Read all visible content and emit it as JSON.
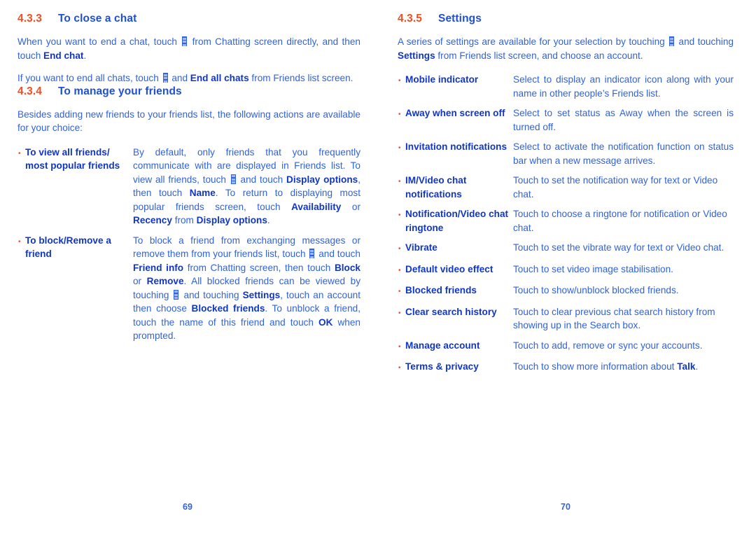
{
  "document": {
    "menu_icon_name": "overflow-menu-icon",
    "accent_orange": "#F04E23",
    "text_blue": "#2F62DE",
    "bold_blue": "#1036C4"
  },
  "left_page": {
    "page_number": "69",
    "sections": [
      {
        "number": "4.3.3",
        "title": "To close a chat",
        "paragraphs": [
          {
            "parts": [
              {
                "t": "text",
                "v": "When you want to end a chat, touch "
              },
              {
                "t": "icon",
                "v": "overflow-menu-icon"
              },
              {
                "t": "text",
                "v": " from Chatting screen directly, and then touch "
              },
              {
                "t": "bold",
                "v": "End chat"
              },
              {
                "t": "text",
                "v": "."
              }
            ]
          },
          {
            "parts": [
              {
                "t": "text",
                "v": "If you want to end all chats, touch "
              },
              {
                "t": "icon",
                "v": "overflow-menu-icon"
              },
              {
                "t": "text",
                "v": " and "
              },
              {
                "t": "bold",
                "v": "End all chats"
              },
              {
                "t": "text",
                "v": " from Friends list screen."
              }
            ]
          }
        ]
      },
      {
        "number": "4.3.4",
        "title": "To manage your friends",
        "paragraphs": [
          {
            "parts": [
              {
                "t": "text",
                "v": "Besides adding new friends to your friends list, the following actions are available for your choice:"
              }
            ]
          }
        ],
        "items": [
          {
            "term": "To view all friends/ most popular friends",
            "desc_parts": [
              {
                "t": "text",
                "v": "By default, only friends that you frequently communicate with are displayed in Friends list. To view all friends, touch "
              },
              {
                "t": "icon",
                "v": "overflow-menu-icon"
              },
              {
                "t": "text",
                "v": " and touch "
              },
              {
                "t": "bold",
                "v": "Display options"
              },
              {
                "t": "text",
                "v": ", then touch "
              },
              {
                "t": "bold",
                "v": "Name"
              },
              {
                "t": "text",
                "v": ". To return to displaying most popular friends screen,  touch "
              },
              {
                "t": "bold",
                "v": "Availability"
              },
              {
                "t": "text",
                "v": " or "
              },
              {
                "t": "bold",
                "v": "Recency"
              },
              {
                "t": "text",
                "v": " from "
              },
              {
                "t": "bold",
                "v": "Display options"
              },
              {
                "t": "text",
                "v": "."
              }
            ]
          },
          {
            "term": "To block/Remove a friend",
            "desc_parts": [
              {
                "t": "text",
                "v": "To block a friend from exchanging messages or remove them from your friends list, touch "
              },
              {
                "t": "icon",
                "v": "overflow-menu-icon"
              },
              {
                "t": "text",
                "v": " and touch "
              },
              {
                "t": "bold",
                "v": "Friend info"
              },
              {
                "t": "text",
                "v": " from Chatting screen, then touch "
              },
              {
                "t": "bold",
                "v": "Block"
              },
              {
                "t": "text",
                "v": " or "
              },
              {
                "t": "bold",
                "v": "Remove"
              },
              {
                "t": "text",
                "v": ". All blocked friends can be viewed by touching "
              },
              {
                "t": "icon",
                "v": "overflow-menu-icon"
              },
              {
                "t": "text",
                "v": " and touching "
              },
              {
                "t": "bold",
                "v": "Settings"
              },
              {
                "t": "text",
                "v": ", touch an account then choose "
              },
              {
                "t": "bold",
                "v": "Blocked friends"
              },
              {
                "t": "text",
                "v": ". To unblock a friend, touch the name of this friend and touch "
              },
              {
                "t": "bold",
                "v": "OK"
              },
              {
                "t": "text",
                "v": " when prompted."
              }
            ]
          }
        ]
      }
    ]
  },
  "right_page": {
    "page_number": "70",
    "sections": [
      {
        "number": "4.3.5",
        "title": "Settings",
        "paragraphs": [
          {
            "parts": [
              {
                "t": "text",
                "v": "A series of settings are available for your selection by touching "
              },
              {
                "t": "icon",
                "v": "overflow-menu-icon"
              },
              {
                "t": "text",
                "v": " and touching "
              },
              {
                "t": "bold",
                "v": "Settings"
              },
              {
                "t": "text",
                "v": " from Friends list screen, and choose an account."
              }
            ]
          }
        ],
        "items": [
          {
            "term": "Mobile indicator",
            "justify": true,
            "desc_parts": [
              {
                "t": "text",
                "v": "Select to display an indicator icon along with your name in other people’s Friends list."
              }
            ]
          },
          {
            "term": "Away when screen off",
            "justify": true,
            "desc_parts": [
              {
                "t": "text",
                "v": "Select to set status as Away when the screen is turned off."
              }
            ]
          },
          {
            "term": "Invitation notifications",
            "justify": true,
            "desc_parts": [
              {
                "t": "text",
                "v": "Select to activate the notification function on status bar when a new message arrives."
              }
            ]
          },
          {
            "term": "IM/Video chat notifications",
            "justify": false,
            "desc_parts": [
              {
                "t": "text",
                "v": "Touch to set the notification way for text or Video chat."
              }
            ]
          },
          {
            "term": "Notification/Video chat ringtone",
            "justify": false,
            "desc_parts": [
              {
                "t": "text",
                "v": "Touch to choose a ringtone for notification or Video chat."
              }
            ]
          },
          {
            "term": "Vibrate",
            "justify": false,
            "desc_parts": [
              {
                "t": "text",
                "v": "Touch to set the vibrate way for text or Video chat."
              }
            ]
          },
          {
            "term": "Default video effect",
            "justify": false,
            "desc_parts": [
              {
                "t": "text",
                "v": "Touch to set video image stabilisation."
              }
            ]
          },
          {
            "term": "Blocked friends",
            "justify": false,
            "desc_parts": [
              {
                "t": "text",
                "v": "Touch to show/unblock blocked friends."
              }
            ]
          },
          {
            "term": "Clear search history",
            "justify": false,
            "desc_parts": [
              {
                "t": "text",
                "v": "Touch to clear previous chat search history from showing up in the Search box."
              }
            ]
          },
          {
            "term": "Manage account",
            "justify": false,
            "desc_parts": [
              {
                "t": "text",
                "v": "Touch to add, remove or sync your accounts."
              }
            ]
          },
          {
            "term": "Terms & privacy",
            "justify": false,
            "desc_parts": [
              {
                "t": "text",
                "v": "Touch to show more information about "
              },
              {
                "t": "bold",
                "v": "Talk"
              },
              {
                "t": "text",
                "v": "."
              }
            ]
          }
        ]
      }
    ]
  }
}
